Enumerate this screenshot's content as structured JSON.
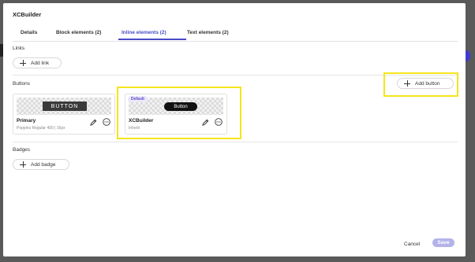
{
  "app": {
    "title": "XCBuilder"
  },
  "tabs": [
    {
      "label": "Details"
    },
    {
      "label": "Block elements (2)"
    },
    {
      "label": "Inline elements (2)"
    },
    {
      "label": "Text elements (2)"
    }
  ],
  "active_tab": 2,
  "sections": {
    "links": {
      "label": "Links",
      "add_label": "Add link"
    },
    "buttons": {
      "label": "Buttons",
      "add_label": "Add button",
      "cards": [
        {
          "preview_text": "BUTTON",
          "name": "Primary",
          "subtitle": "Poppins Regular 400 | 16px"
        },
        {
          "badge": "Default",
          "preview_text": "Button",
          "name": "XCBuilder",
          "subtitle": "Inherit"
        }
      ]
    },
    "badges": {
      "label": "Badges",
      "add_label": "Add badge"
    }
  },
  "footer": {
    "cancel_label": "Cancel",
    "save_label": "Save"
  },
  "colors": {
    "accent": "#4b4bc8",
    "highlight": "#f5e51b",
    "save_disabled": "#b3b3ea"
  },
  "icons": {
    "add": "plus-icon",
    "edit": "pencil-icon",
    "more": "more-icon"
  }
}
